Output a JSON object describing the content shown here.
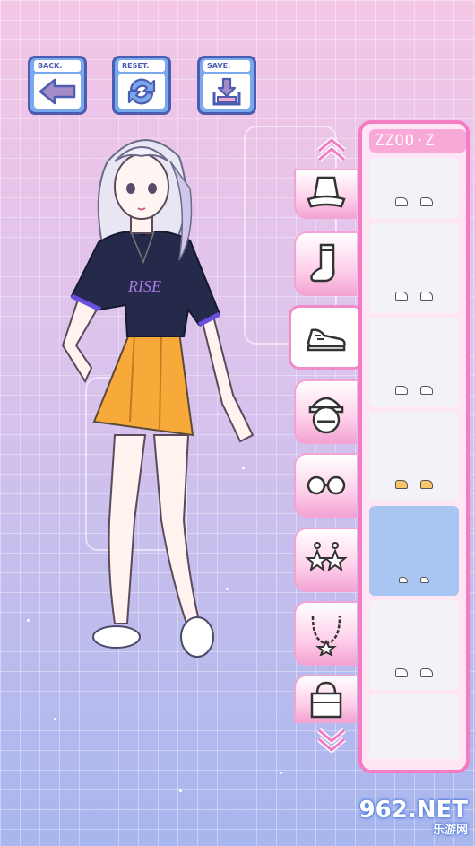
{
  "toolbar": {
    "back_label": "BACK.",
    "reset_label": "RESET.",
    "save_label": "SAVE."
  },
  "character": {
    "shirt_text": "RISE"
  },
  "panel": {
    "title": "ZZOO·Z"
  },
  "categories": [
    {
      "name": "hat",
      "icon": "bucket-hat-icon"
    },
    {
      "name": "socks",
      "icon": "sock-icon"
    },
    {
      "name": "shoes",
      "icon": "sneaker-icon",
      "active": true
    },
    {
      "name": "cap",
      "icon": "cap-icon"
    },
    {
      "name": "glasses",
      "icon": "glasses-icon"
    },
    {
      "name": "earrings",
      "icon": "star-earrings-icon"
    },
    {
      "name": "necklace",
      "icon": "necklace-icon"
    },
    {
      "name": "bag",
      "icon": "bag-icon"
    }
  ],
  "items": [
    {
      "selected": false
    },
    {
      "selected": false
    },
    {
      "selected": false
    },
    {
      "selected": false
    },
    {
      "selected": true
    },
    {
      "selected": false
    },
    {
      "selected": false
    }
  ],
  "watermark": {
    "brand": "962.NET",
    "sub": "乐游网"
  },
  "colors": {
    "accent_pink": "#f37cc4",
    "button_blue": "#7aa8ec",
    "selected_slot": "#a9c6f2"
  }
}
